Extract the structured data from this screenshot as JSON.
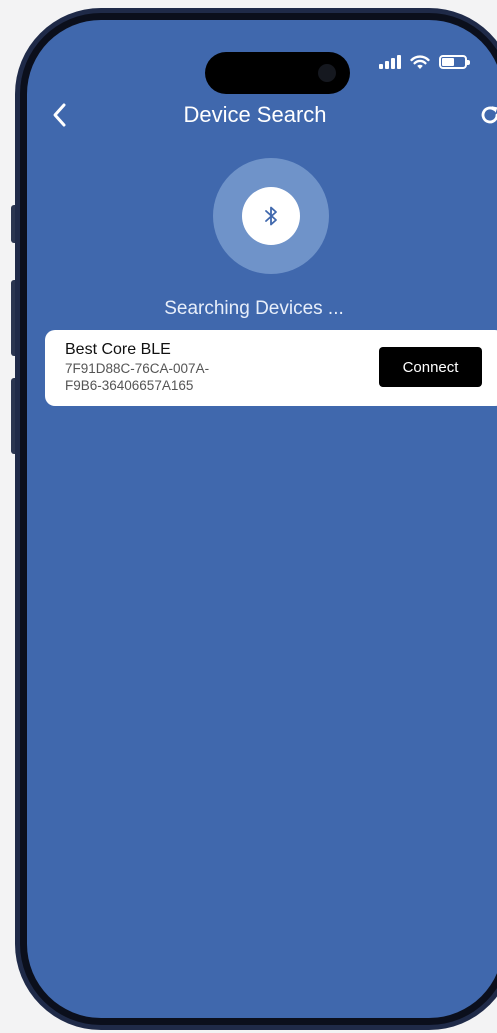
{
  "header": {
    "title": "Device Search",
    "back_icon": "chevron-left-icon",
    "refresh_icon": "refresh-icon"
  },
  "status_bar": {
    "icons": [
      "cellular-signal-icon",
      "wifi-icon",
      "battery-icon"
    ]
  },
  "search": {
    "icon": "bluetooth-icon",
    "status_text": "Searching Devices ..."
  },
  "devices": [
    {
      "name": "Best Core BLE",
      "id_line1": "7F91D88C-76CA-007A-",
      "id_line2": "F9B6-36406657A165",
      "action_label": "Connect"
    }
  ],
  "colors": {
    "screen_background": "#4068ad",
    "indicator_ring": "#6f93c9",
    "card_background": "#ffffff",
    "button_background": "#000000",
    "phone_frame": "#1f2a48"
  }
}
